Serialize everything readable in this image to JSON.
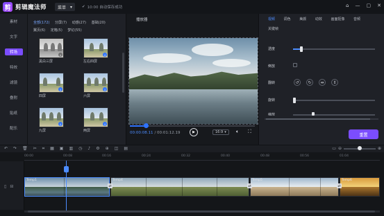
{
  "app": {
    "logo_glyph": "剪",
    "title": "剪辑魔法师",
    "menu_label": "菜单",
    "save_status": "10:00 自动保存成功"
  },
  "window": {
    "home_icon": "⌂",
    "min_icon": "—",
    "max_icon": "▢",
    "close_icon": "✕"
  },
  "leftnav": [
    "素材",
    "文字",
    "转场",
    "特效",
    "滤镜",
    "叠附",
    "贴纸",
    "配乐"
  ],
  "transitions": {
    "categories": [
      "全部(172)",
      "分屏(7)",
      "动感(27)",
      "基础(20)",
      "翼页(6)",
      "定格(5)",
      "梦幻(55)"
    ],
    "items": [
      {
        "label": "黑白三屏"
      },
      {
        "label": "左右四屏"
      },
      {
        "label": "四屏"
      },
      {
        "label": "六屏"
      },
      {
        "label": "九屏"
      },
      {
        "label": "两屏"
      }
    ]
  },
  "player": {
    "title": "播放器",
    "current_time": "00:00:08.11",
    "total_time": "/ 00:01:12.19",
    "progress": 0.13,
    "ratio": "16:9"
  },
  "props": {
    "tabs": [
      "视频",
      "调色",
      "美颜",
      "动效",
      "画面抠像",
      "音频",
      "关键帧"
    ],
    "opacity_label": "透度",
    "opacity_value": 0.1,
    "reverse_label": "倒放",
    "flip_label": "翻转",
    "rotate_label": "旋转",
    "rotate_value": 0.0,
    "scale_label": "缩放",
    "reset_label": "重置"
  },
  "timeline": {
    "ruler": [
      "00:00",
      "00:08",
      "00:16",
      "00:24",
      "00:32",
      "00:40",
      "00:48",
      "00:56",
      "01:04"
    ],
    "clips": [
      {
        "label": "Temp1"
      },
      {
        "label": "Temp4"
      },
      {
        "label": "Temp5"
      },
      {
        "label": "Temp6"
      }
    ]
  },
  "colors": {
    "accent": "#7b4dff",
    "blue": "#4d8dff"
  }
}
